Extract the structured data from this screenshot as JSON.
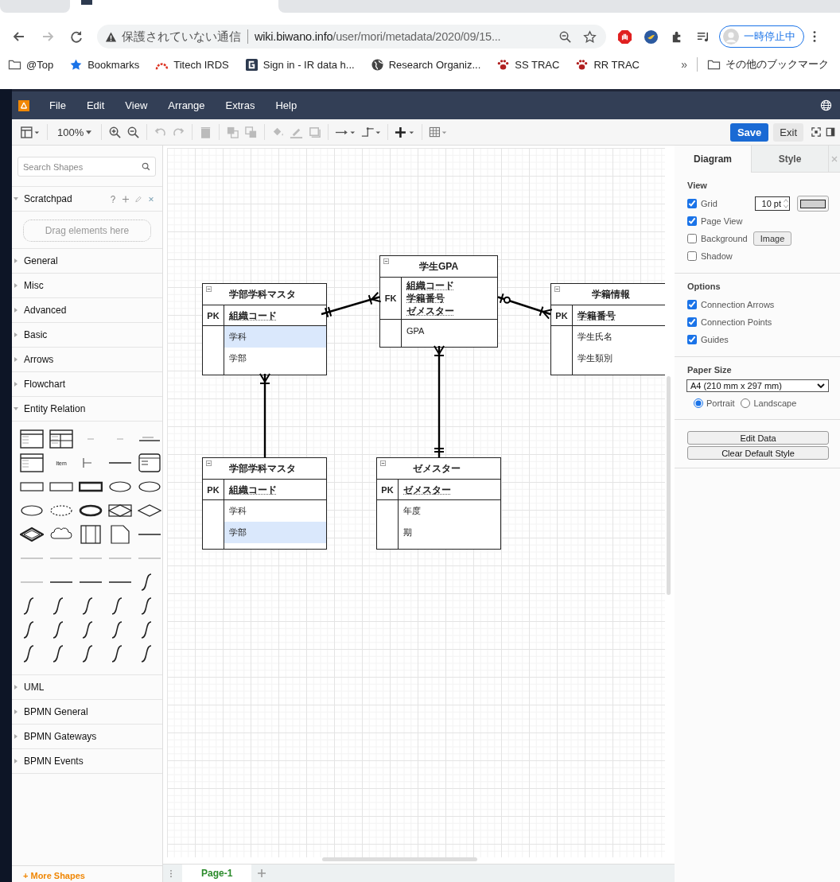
{
  "browser": {
    "tabs": [
      {
        "selected": false
      },
      {
        "selected": true
      },
      {
        "selected": false
      }
    ],
    "forward_enabled": false,
    "security_label": "保護されていない通信",
    "url_host": "wiki.biwano.info",
    "url_path": "/user/mori/metadata/2020/09/15...",
    "profile_label": "一時停止中",
    "bookmarks": [
      {
        "kind": "folder",
        "label": "@Top"
      },
      {
        "kind": "star",
        "label": "Bookmarks"
      },
      {
        "kind": "arc",
        "label": "Titech IRDS"
      },
      {
        "kind": "square",
        "label": "Sign in - IR data h..."
      },
      {
        "kind": "globe",
        "label": "Research Organiz..."
      },
      {
        "kind": "paw",
        "label": "SS TRAC"
      },
      {
        "kind": "paw",
        "label": "RR TRAC"
      }
    ],
    "overflow": "»",
    "other_bookmarks": "その他のブックマーク"
  },
  "app": {
    "menu": [
      "File",
      "Edit",
      "View",
      "Arrange",
      "Extras",
      "Help"
    ],
    "toolbar": {
      "zoom_label": "100%",
      "history_enabled": false,
      "arrange_enabled": false,
      "style_enabled": false
    },
    "save": "Save",
    "exit": "Exit"
  },
  "sidebar": {
    "search_placeholder": "Search Shapes",
    "scratchpad": {
      "title": "Scratchpad",
      "expanded": true,
      "drop_hint": "Drag elements here"
    },
    "sections": [
      {
        "label": "General",
        "expanded": false
      },
      {
        "label": "Misc",
        "expanded": false
      },
      {
        "label": "Advanced",
        "expanded": false
      },
      {
        "label": "Basic",
        "expanded": false
      },
      {
        "label": "Arrows",
        "expanded": false
      },
      {
        "label": "Flowchart",
        "expanded": false
      },
      {
        "label": "Entity Relation",
        "expanded": true,
        "shapes": [
          {
            "kind": "table"
          },
          {
            "kind": "table-split"
          },
          {
            "kind": "dash"
          },
          {
            "kind": "dash"
          },
          {
            "kind": "label-line"
          },
          {
            "kind": "table"
          },
          {
            "kind": "item",
            "label": "Item"
          },
          {
            "kind": "tree"
          },
          {
            "kind": "line"
          },
          {
            "kind": "rounded-table"
          },
          {
            "kind": "rect"
          },
          {
            "kind": "rect"
          },
          {
            "kind": "double-rect"
          },
          {
            "kind": "ellipse"
          },
          {
            "kind": "ellipse"
          },
          {
            "kind": "ellipse"
          },
          {
            "kind": "dashed-ellipse"
          },
          {
            "kind": "bold-ellipse"
          },
          {
            "kind": "diamond-rect"
          },
          {
            "kind": "diamond"
          },
          {
            "kind": "double-diamond"
          },
          {
            "kind": "cloud"
          },
          {
            "kind": "split-rect"
          },
          {
            "kind": "note"
          },
          {
            "kind": "line"
          },
          {
            "kind": "thin-line"
          },
          {
            "kind": "thin-line"
          },
          {
            "kind": "thin-line"
          },
          {
            "kind": "thin-line"
          },
          {
            "kind": "thin-line"
          },
          {
            "kind": "thin-line"
          },
          {
            "kind": "line"
          },
          {
            "kind": "line"
          },
          {
            "kind": "line"
          },
          {
            "kind": "curve"
          },
          {
            "kind": "curve"
          },
          {
            "kind": "curve"
          },
          {
            "kind": "curve"
          },
          {
            "kind": "curve"
          },
          {
            "kind": "curve"
          },
          {
            "kind": "curve"
          },
          {
            "kind": "curve"
          },
          {
            "kind": "curve"
          },
          {
            "kind": "curve"
          },
          {
            "kind": "curve"
          },
          {
            "kind": "curve"
          },
          {
            "kind": "curve"
          },
          {
            "kind": "curve"
          },
          {
            "kind": "curve"
          },
          {
            "kind": "curve"
          }
        ]
      },
      {
        "label": "UML",
        "expanded": false
      },
      {
        "label": "BPMN General",
        "expanded": false
      },
      {
        "label": "BPMN Gateways",
        "expanded": false
      },
      {
        "label": "BPMN Events",
        "expanded": false
      }
    ],
    "more_shapes": "+ More Shapes"
  },
  "diagram": {
    "entities": [
      {
        "title": "学部学科マスタ",
        "keys": [
          {
            "key": "PK",
            "fields": [
              "組織コード"
            ]
          }
        ],
        "attributes": [
          {
            "text": "学科",
            "selected": true
          },
          {
            "text": "学部",
            "selected": false
          }
        ]
      },
      {
        "title": "学生GPA",
        "keys": [
          {
            "key": "FK",
            "fields": [
              "組織コード",
              "学籍番号",
              "ゼメスター"
            ]
          }
        ],
        "attributes": [
          {
            "text": "GPA",
            "selected": false
          }
        ]
      },
      {
        "title": "学籍情報",
        "keys": [
          {
            "key": "PK",
            "fields": [
              "学籍番号"
            ]
          }
        ],
        "attributes": [
          {
            "text": "学生氏名",
            "selected": false
          },
          {
            "text": "学生類別",
            "selected": false
          }
        ]
      },
      {
        "title": "学部学科マスタ",
        "keys": [
          {
            "key": "PK",
            "fields": [
              "組織コード"
            ]
          }
        ],
        "attributes": [
          {
            "text": "学科",
            "selected": false
          },
          {
            "text": "学部",
            "selected": true
          }
        ]
      },
      {
        "title": "ゼメスター",
        "keys": [
          {
            "key": "PK",
            "fields": [
              "ゼメスター"
            ]
          }
        ],
        "attributes": [
          {
            "text": "年度",
            "selected": false
          },
          {
            "text": "期",
            "selected": false
          }
        ]
      }
    ],
    "connectors": [
      {
        "ends": [
          {
            "kind": "one-only"
          },
          {
            "kind": "one-many"
          }
        ]
      },
      {
        "ends": [
          {
            "kind": "zero-one"
          },
          {
            "kind": "one-many"
          }
        ]
      },
      {
        "ends": [
          {
            "kind": "one-many"
          },
          {
            "kind": "one-only"
          }
        ]
      },
      {
        "ends": [
          {
            "kind": "one-many"
          },
          {
            "kind": "none"
          }
        ]
      }
    ]
  },
  "page_tabs": [
    {
      "label": "Page-1",
      "selected": true
    }
  ],
  "format_panel": {
    "tabs": [
      {
        "label": "Diagram",
        "selected": true
      },
      {
        "label": "Style",
        "selected": false
      }
    ],
    "view": {
      "title": "View",
      "options": [
        {
          "kind": "grid",
          "label": "Grid",
          "checked": true,
          "value": "10 pt"
        },
        {
          "kind": "plain",
          "label": "Page View",
          "checked": true
        },
        {
          "kind": "image",
          "label": "Background",
          "checked": false,
          "button": "Image"
        },
        {
          "kind": "plain",
          "label": "Shadow",
          "checked": false
        }
      ]
    },
    "options": {
      "title": "Options",
      "options": [
        {
          "label": "Connection Arrows",
          "checked": true
        },
        {
          "label": "Connection Points",
          "checked": true
        },
        {
          "label": "Guides",
          "checked": true
        }
      ]
    },
    "paper": {
      "title": "Paper Size",
      "value": "A4 (210 mm x 297 mm)",
      "orientations": [
        {
          "label": "Portrait",
          "selected": true
        },
        {
          "label": "Landscape",
          "selected": false
        }
      ]
    },
    "buttons": [
      "Edit Data",
      "Clear Default Style"
    ]
  }
}
